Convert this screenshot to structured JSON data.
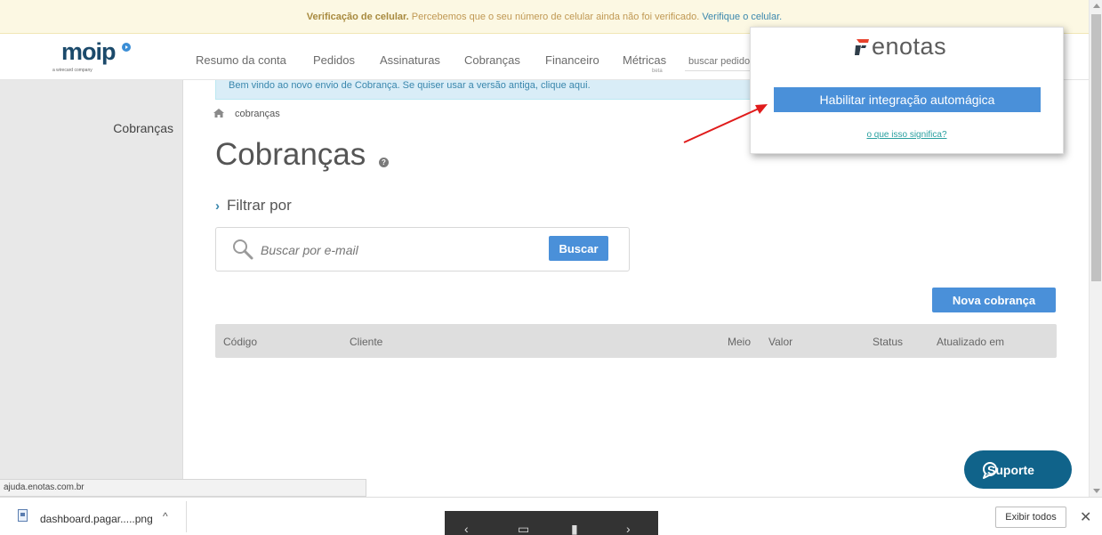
{
  "verify_bar": {
    "strong": "Verificação de celular.",
    "text": " Percebemos que o seu número de celular ainda não foi verificado. ",
    "link": "Verifique o celular."
  },
  "header": {
    "logo": "moip",
    "logo_sub": "a wirecard company",
    "nav": [
      "Resumo da conta",
      "Pedidos",
      "Assinaturas",
      "Cobranças",
      "Financeiro",
      "Métricas"
    ],
    "nav_sub": "beta",
    "search_placeholder": "buscar pedido"
  },
  "sidebar": {
    "title": "Cobranças"
  },
  "welcome": "Bem vindo ao novo envio de Cobrança. Se quiser usar a versão antiga, clique aqui.",
  "breadcrumb": "cobranças",
  "main": {
    "title": "Cobranças",
    "filter_label": "Filtrar por",
    "search_placeholder": "Buscar por e-mail",
    "search_button": "Buscar",
    "new_button": "Nova cobrança"
  },
  "table": {
    "columns": [
      "Código",
      "Cliente",
      "Meio",
      "Valor",
      "Status",
      "Atualizado em"
    ]
  },
  "popup": {
    "logo_text": "enotas",
    "button": "Habilitar integração automágica",
    "link": "o que isso significa?"
  },
  "support_button": "Suporte",
  "status_url": "ajuda.enotas.com.br",
  "download": {
    "file_name": "dashboard.pagar.....png",
    "show_all": "Exibir todos",
    "close": "✕"
  },
  "icons": {
    "home": "home-icon",
    "help": "help-icon",
    "search": "magnifier-icon",
    "chat": "chat-bubble-icon",
    "file": "image-file-icon"
  },
  "colors": {
    "primary_button": "#4a90d9",
    "support_button": "#10638a",
    "arrow": "#e01b1b"
  }
}
